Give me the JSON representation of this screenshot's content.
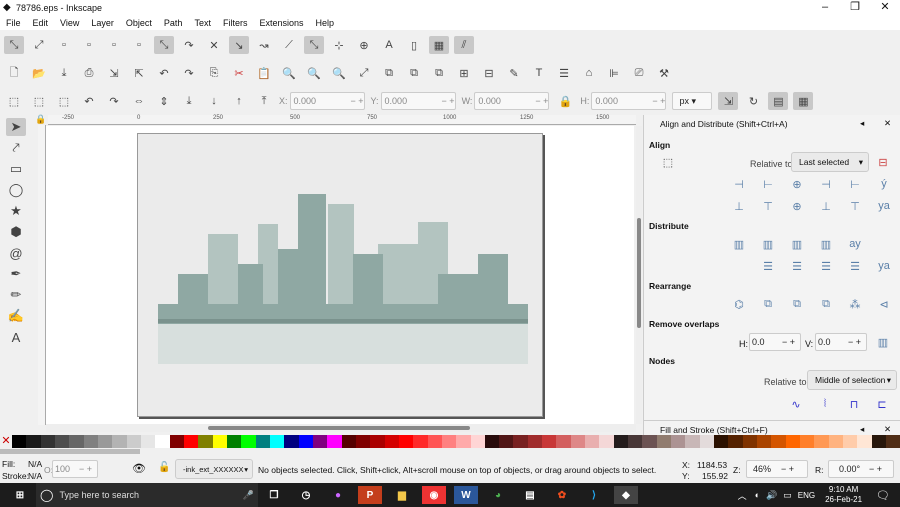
{
  "window": {
    "title": "78786.eps - Inkscape",
    "min": "–",
    "max": "❐",
    "close": "✕"
  },
  "menu": [
    "File",
    "Edit",
    "View",
    "Layer",
    "Object",
    "Path",
    "Text",
    "Filters",
    "Extensions",
    "Help"
  ],
  "toolbar3": {
    "x_label": "X:",
    "x": "0.000",
    "y_label": "Y:",
    "y": "0.000",
    "w_label": "W:",
    "w": "0.000",
    "h_label": "H:",
    "h": "0.000",
    "unit": "px"
  },
  "ruler": [
    "-250",
    "0",
    "250",
    "500",
    "750",
    "1000",
    "1250",
    "1500"
  ],
  "dock": {
    "align_title": "Align and Distribute (Shift+Ctrl+A)",
    "align": "Align",
    "relative_label": "Relative to:",
    "relative_value": "Last selected",
    "distribute": "Distribute",
    "rearrange": "Rearrange",
    "remove_overlaps": "Remove overlaps",
    "h_label": "H:",
    "h_value": "0.0",
    "v_label": "V:",
    "v_value": "0.0",
    "nodes": "Nodes",
    "nodes_relative_label": "Relative to:",
    "nodes_relative_value": "Middle of selection",
    "fill_title": "Fill and Stroke (Shift+Ctrl+F)"
  },
  "palette": [
    "#000000",
    "#1a1a1a",
    "#333333",
    "#4d4d4d",
    "#666666",
    "#808080",
    "#999999",
    "#b3b3b3",
    "#cccccc",
    "#e6e6e6",
    "#ffffff",
    "#800000",
    "#ff0000",
    "#808000",
    "#ffff00",
    "#008000",
    "#00ff00",
    "#008080",
    "#00ffff",
    "#000080",
    "#0000ff",
    "#800080",
    "#ff00ff",
    "#550000",
    "#800000",
    "#aa0000",
    "#d40000",
    "#ff0000",
    "#ff2a2a",
    "#ff5555",
    "#ff8080",
    "#ffaaaa",
    "#ffd5d5",
    "#280b0b",
    "#501616",
    "#782121",
    "#a02c2c",
    "#c83737",
    "#d35f5f",
    "#de8787",
    "#e9afaf",
    "#f4d7d7",
    "#241c1c",
    "#483737",
    "#6c5353",
    "#917c6f",
    "#ac9393",
    "#c8b7b7",
    "#e3dbdb",
    "#2b1100",
    "#552200",
    "#803300",
    "#aa4400",
    "#d45500",
    "#ff6600",
    "#ff7f2a",
    "#ff9955",
    "#ffb380",
    "#ffccaa",
    "#ffe6d5",
    "#28170b",
    "#502d16"
  ],
  "status": {
    "fill_label": "Fill:",
    "fill": "N/A",
    "stroke_label": "Stroke:",
    "stroke": "N/A",
    "opacity_label": "O:",
    "opacity": "100",
    "layer": "-ink_ext_XXXXXX",
    "message": "No objects selected. Click, Shift+click, Alt+scroll mouse on top of objects, or drag around objects to select.",
    "x_label": "X:",
    "x": "1184.53",
    "y_label": "Y:",
    "y": "155.92",
    "zoom_label": "Z:",
    "zoom": "46%",
    "rot_label": "R:",
    "rotation": "0.00°"
  },
  "taskbar": {
    "search": "Type here to search",
    "time": "9:10 AM",
    "date": "26-Feb-21",
    "lang": "ENG"
  }
}
